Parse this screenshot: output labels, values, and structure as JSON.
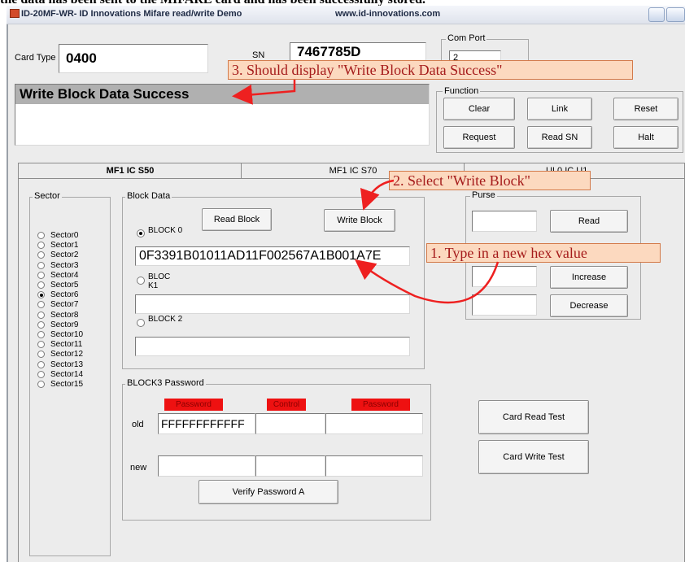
{
  "caption": "the data has been sent to the MIFARE card and has been successfully stored.",
  "window": {
    "title": "ID-20MF-WR- ID Innovations Mifare read/write Demo",
    "url": "www.id-innovations.com"
  },
  "card": {
    "card_type_label": "Card Type",
    "card_type_value": "0400",
    "sn_label": "SN",
    "sn_value": "7467785D"
  },
  "status": {
    "message": "Write Block Data Success"
  },
  "com_port": {
    "legend": "Com Port",
    "value": "2"
  },
  "function": {
    "legend": "Function",
    "buttons": [
      "Clear",
      "Link",
      "Reset",
      "Request",
      "Read SN",
      "Halt"
    ]
  },
  "tabs": [
    "MF1 IC S50",
    "MF1 IC S70",
    "UL0 IC U1"
  ],
  "sector": {
    "legend": "Sector",
    "items": [
      "Sector0",
      "Sector1",
      "Sector2",
      "Sector3",
      "Sector4",
      "Sector5",
      "Sector6",
      "Sector7",
      "Sector8",
      "Sector9",
      "Sector10",
      "Sector11",
      "Sector12",
      "Sector13",
      "Sector14",
      "Sector15"
    ],
    "selected": "Sector6"
  },
  "block_data": {
    "legend": "Block Data",
    "read_block": "Read Block",
    "write_block": "Write Block",
    "block0_label": "BLOCK 0",
    "block0_value": "0F3391B01011AD11F002567A1B001A7E",
    "block1_label": "BLOC K1",
    "block1_value": "",
    "block2_label": "BLOCK 2",
    "block2_value": ""
  },
  "password": {
    "legend": "BLOCK3 Password",
    "hdr_password": "Password",
    "hdr_control": "Control",
    "hdr_password2": "Password",
    "old_label": "old",
    "old_value": "FFFFFFFFFFFF",
    "new_label": "new",
    "verify_button": "Verify Password A"
  },
  "purse": {
    "legend": "Purse",
    "read": "Read",
    "increase": "Increase",
    "decrease": "Decrease"
  },
  "tests": {
    "card_read_test": "Card Read Test",
    "card_write_test": "Card Write Test"
  },
  "annotations": {
    "step1": "1. Type in a new hex value",
    "step2": "2. Select \"Write Block\"",
    "step3": "3. Should display \"Write Block Data Success\""
  },
  "colors": {
    "annotation_fill": "#fcd9bf",
    "annotation_text": "#a51b1b",
    "arrow_red": "#ee2020",
    "password_header_red": "#ee1111"
  }
}
